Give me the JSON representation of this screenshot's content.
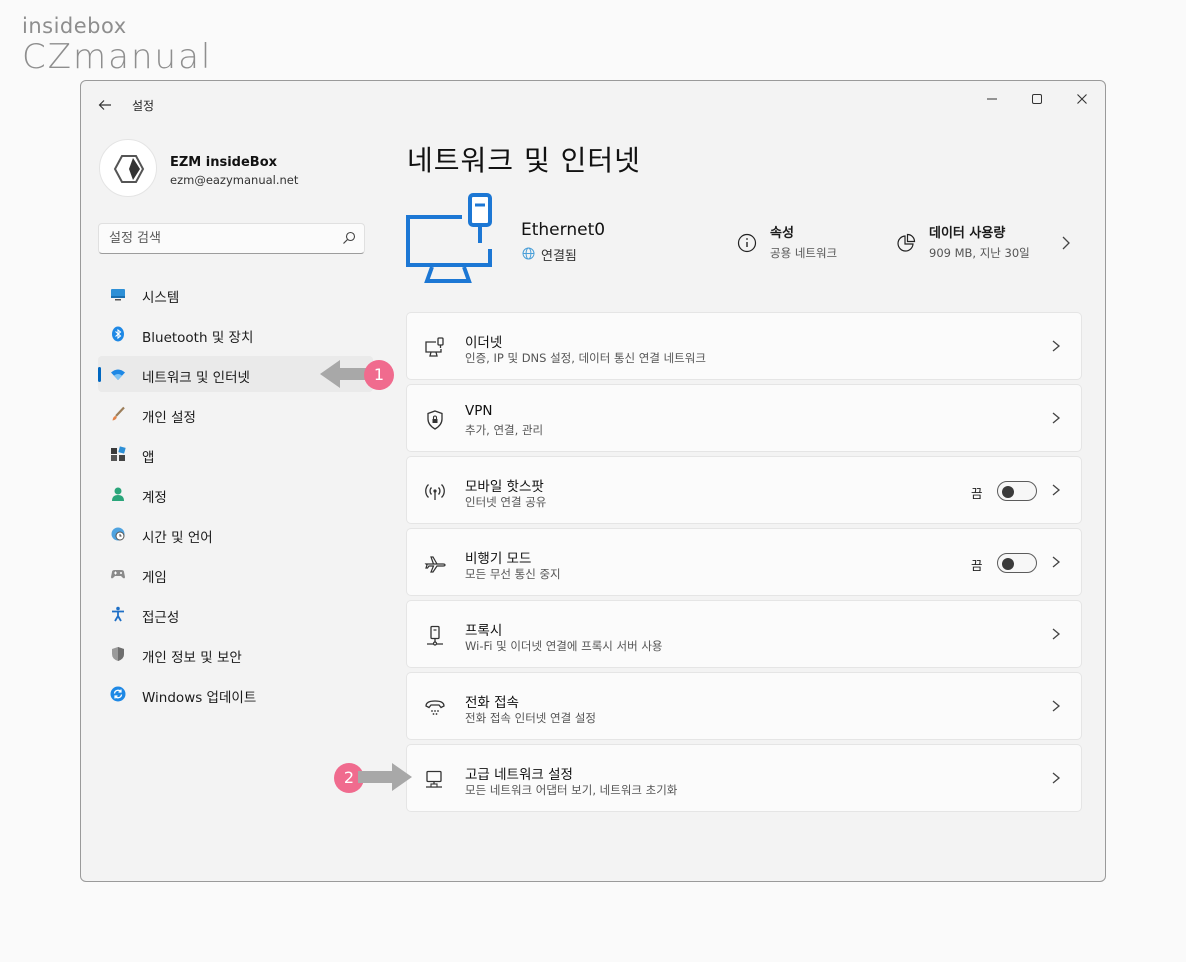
{
  "watermark": {
    "line1": "insidebox",
    "line2": "CZmanual"
  },
  "window": {
    "title": "설정"
  },
  "profile": {
    "name": "EZM insideBox",
    "email": "ezm@eazymanual.net"
  },
  "search": {
    "placeholder": "설정 검색"
  },
  "sidebar": {
    "items": [
      {
        "label": "시스템",
        "icon": "system-icon"
      },
      {
        "label": "Bluetooth 및 장치",
        "icon": "bluetooth-icon"
      },
      {
        "label": "네트워크 및 인터넷",
        "icon": "wifi-icon",
        "active": true
      },
      {
        "label": "개인 설정",
        "icon": "brush-icon"
      },
      {
        "label": "앱",
        "icon": "apps-icon"
      },
      {
        "label": "계정",
        "icon": "account-icon"
      },
      {
        "label": "시간 및 언어",
        "icon": "globe-clock-icon"
      },
      {
        "label": "게임",
        "icon": "gamepad-icon"
      },
      {
        "label": "접근성",
        "icon": "accessibility-icon"
      },
      {
        "label": "개인 정보 및 보안",
        "icon": "shield-icon"
      },
      {
        "label": "Windows 업데이트",
        "icon": "update-icon"
      }
    ]
  },
  "page": {
    "title": "네트워크 및 인터넷"
  },
  "connection": {
    "name": "Ethernet0",
    "status": "연결됨",
    "properties_title": "속성",
    "properties_sub": "공용 네트워크",
    "data_title": "데이터 사용량",
    "data_sub": "909 MB, 지난 30일"
  },
  "cards": [
    {
      "title": "이더넷",
      "sub": "인증, IP 및 DNS 설정, 데이터 통신 연결 네트워크",
      "icon": "ethernet-icon"
    },
    {
      "title": "VPN",
      "sub": "추가, 연결, 관리",
      "icon": "vpn-shield-icon"
    },
    {
      "title": "모바일 핫스팟",
      "sub": "인터넷 연결 공유",
      "icon": "hotspot-icon",
      "toggle_label": "끔"
    },
    {
      "title": "비행기 모드",
      "sub": "모든 무선 통신 중지",
      "icon": "airplane-icon",
      "toggle_label": "끔"
    },
    {
      "title": "프록시",
      "sub": "Wi-Fi 및 이더넷 연결에 프록시 서버 사용",
      "icon": "proxy-icon"
    },
    {
      "title": "전화 접속",
      "sub": "전화 접속 인터넷 연결 설정",
      "icon": "dialup-icon"
    },
    {
      "title": "고급 네트워크 설정",
      "sub": "모든 네트워크 어댑터 보기, 네트워크 초기화",
      "icon": "advanced-network-icon"
    }
  ],
  "annotations": {
    "badge1": "1",
    "badge2": "2"
  },
  "colors": {
    "accent": "#0067c0",
    "badge": "#f06b8e",
    "arrow": "#a8a8a8"
  }
}
